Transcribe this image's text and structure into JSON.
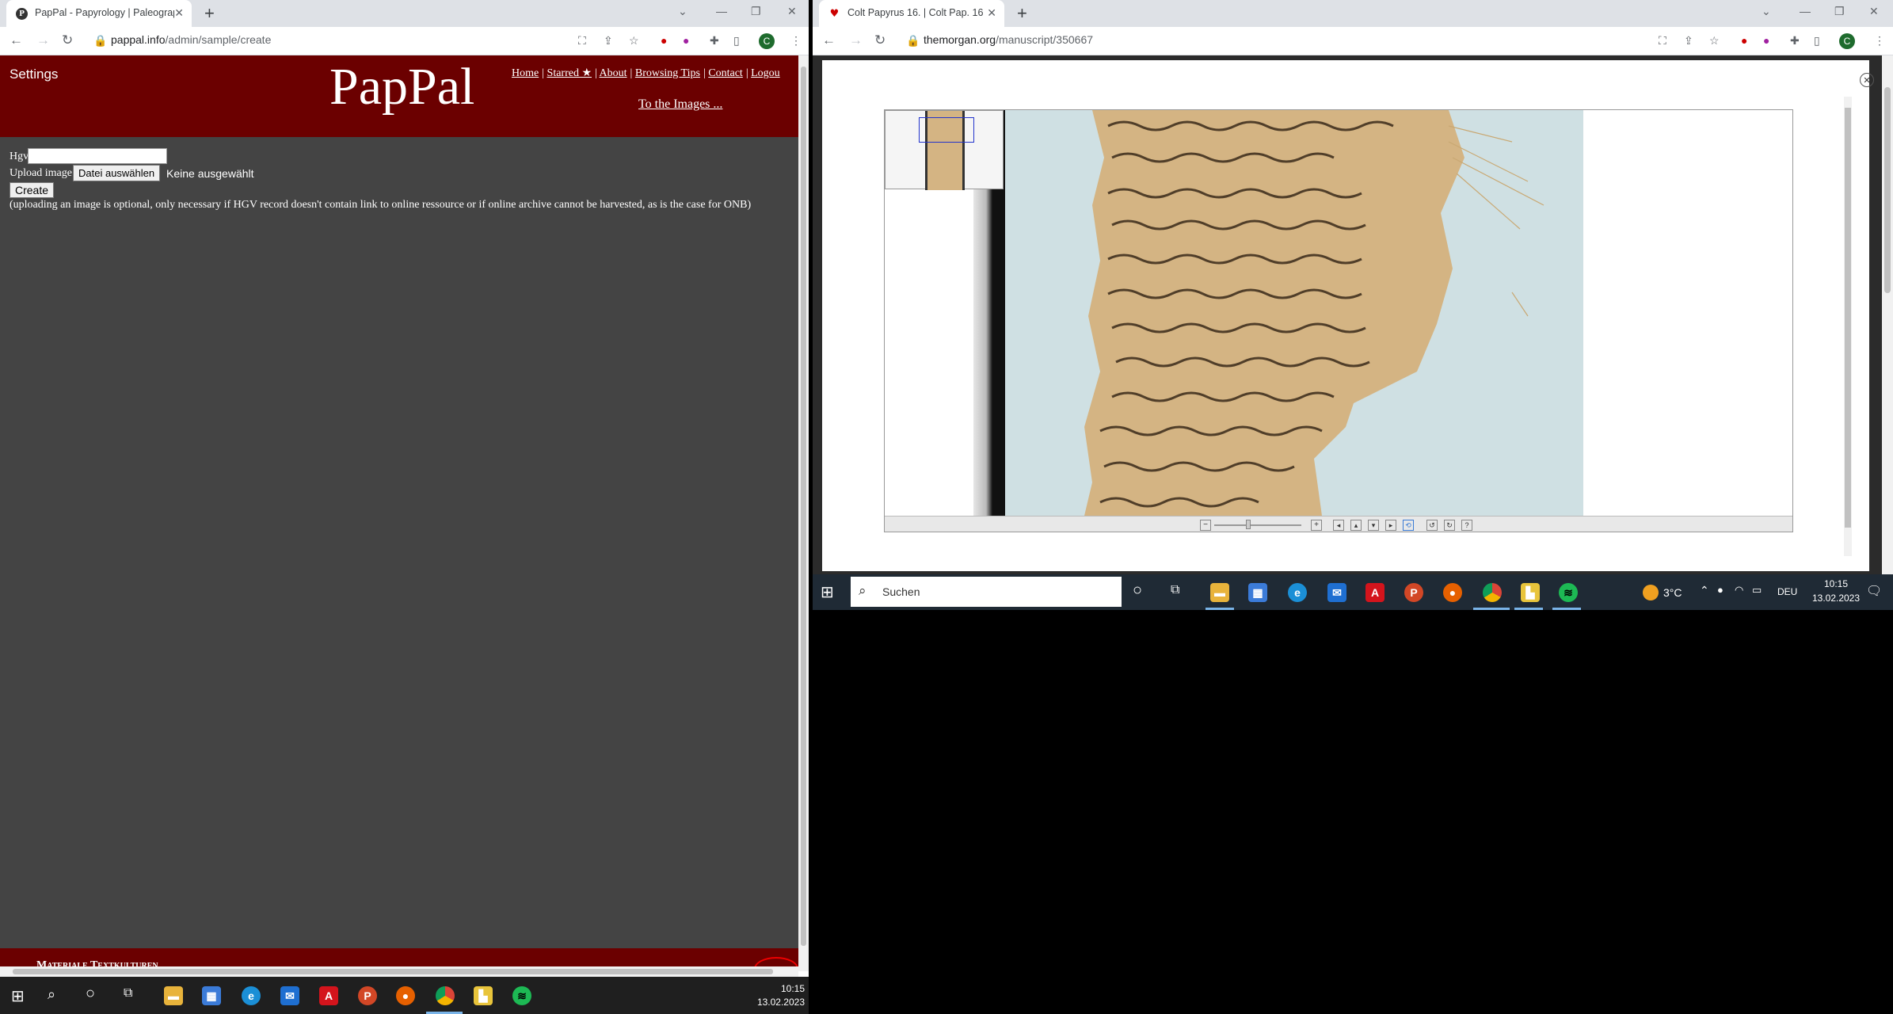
{
  "left_browser": {
    "tab_title": "PapPal - Papyrology | Paleograph",
    "url_domain": "pappal.info",
    "url_path": "/admin/sample/create",
    "profile_initial": "C",
    "site": {
      "settings": "Settings",
      "logo": "PapPal",
      "nav": [
        "Home",
        "Starred ★",
        "About",
        "Browsing Tips",
        "Contact",
        "Logou"
      ],
      "to_images": "To the Images ...",
      "form": {
        "hgv_label": "Hgv",
        "hgv_value": "",
        "upload_label": "Upload image",
        "choose_file_button": "Datei auswählen",
        "no_file_text": "Keine ausgewählt",
        "create_button": "Create",
        "note": "(uploading an image is optional, only necessary if HGV record doesn't contain link to online ressource or if online archive cannot be harvested, as is the case for ONB)"
      },
      "footer_text": "Materiale Textkulturen"
    }
  },
  "right_browser": {
    "tab_title": "Colt Papyrus 16. | Colt Pap. 16 | T",
    "url_domain": "themorgan.org",
    "url_path": "/manuscript/350667",
    "profile_initial": "C"
  },
  "taskbar_left": {
    "time": "10:15",
    "date": "13.02.2023"
  },
  "taskbar_right": {
    "search_placeholder": "Suchen",
    "weather": "3°C",
    "language": "DEU",
    "time": "10:15",
    "date": "13.02.2023"
  },
  "colors": {
    "pappal_red": "#6b0000",
    "pappal_gray": "#444444",
    "papyrus": "#d4b483",
    "viewer_bg": "#cfe0e3"
  }
}
